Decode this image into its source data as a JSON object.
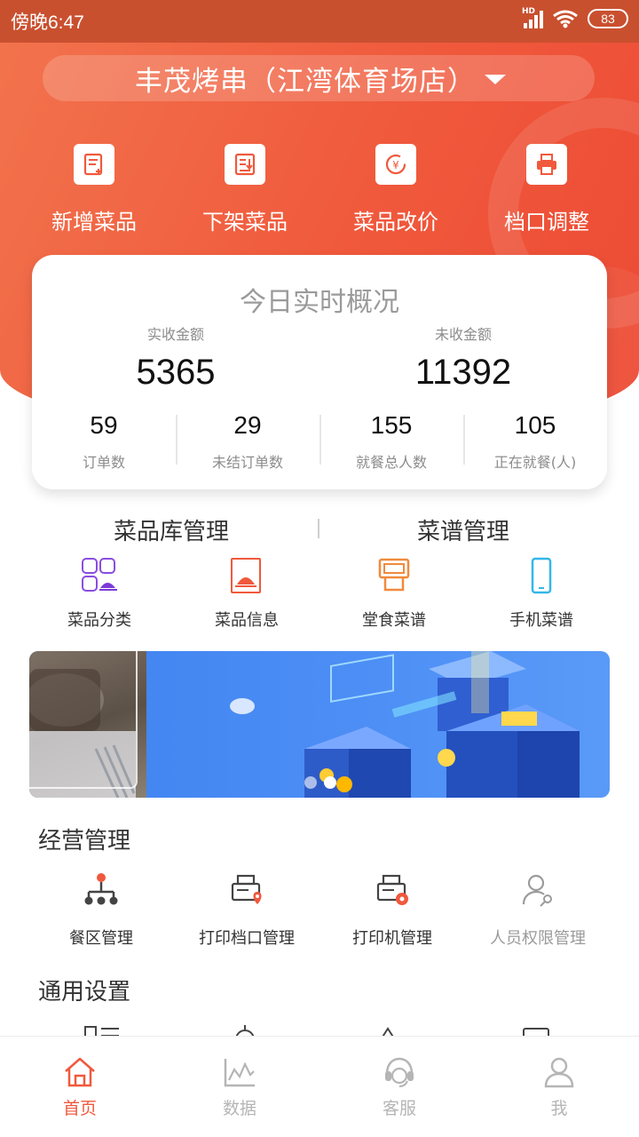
{
  "status_bar": {
    "time": "傍晚6:47",
    "network": "HD",
    "battery": "83"
  },
  "store": {
    "name": "丰茂烤串（江湾体育场店）"
  },
  "quick_actions": [
    {
      "label": "新增菜品",
      "icon": "add-dish-icon"
    },
    {
      "label": "下架菜品",
      "icon": "remove-dish-icon"
    },
    {
      "label": "菜品改价",
      "icon": "price-change-icon"
    },
    {
      "label": "档口调整",
      "icon": "printer-icon"
    }
  ],
  "overview": {
    "title": "今日实时概况",
    "received_label": "实收金额",
    "received_value": "5365",
    "unreceived_label": "未收金额",
    "unreceived_value": "11392",
    "stats": [
      {
        "value": "59",
        "label": "订单数"
      },
      {
        "value": "29",
        "label": "未结订单数"
      },
      {
        "value": "155",
        "label": "就餐总人数"
      },
      {
        "value": "105",
        "label": "正在就餐(人)"
      }
    ]
  },
  "library": {
    "left_title": "菜品库管理",
    "right_title": "菜谱管理",
    "items": [
      {
        "label": "菜品分类",
        "icon": "dish-category-icon",
        "color": "#7b3ad8"
      },
      {
        "label": "菜品信息",
        "icon": "dish-info-icon",
        "color": "#f0593c"
      },
      {
        "label": "堂食菜谱",
        "icon": "dine-in-menu-icon",
        "color": "#f08a3c"
      },
      {
        "label": "手机菜谱",
        "icon": "mobile-menu-icon",
        "color": "#33b7e8"
      }
    ]
  },
  "banner": {
    "pages": 2,
    "active_page": 2
  },
  "business": {
    "title": "经营管理",
    "items": [
      {
        "label": "餐区管理",
        "icon": "dining-area-icon"
      },
      {
        "label": "打印档口管理",
        "icon": "print-station-icon"
      },
      {
        "label": "打印机管理",
        "icon": "printer-manage-icon"
      },
      {
        "label": "人员权限管理",
        "icon": "staff-permission-icon"
      }
    ]
  },
  "settings": {
    "title": "通用设置"
  },
  "tabs": [
    {
      "label": "首页",
      "icon": "home-icon",
      "active": true
    },
    {
      "label": "数据",
      "icon": "chart-icon",
      "active": false
    },
    {
      "label": "客服",
      "icon": "support-icon",
      "active": false
    },
    {
      "label": "我",
      "icon": "user-icon",
      "active": false
    }
  ],
  "colors": {
    "accent": "#f0593c",
    "text": "#333333",
    "muted": "#8c8c8c"
  }
}
